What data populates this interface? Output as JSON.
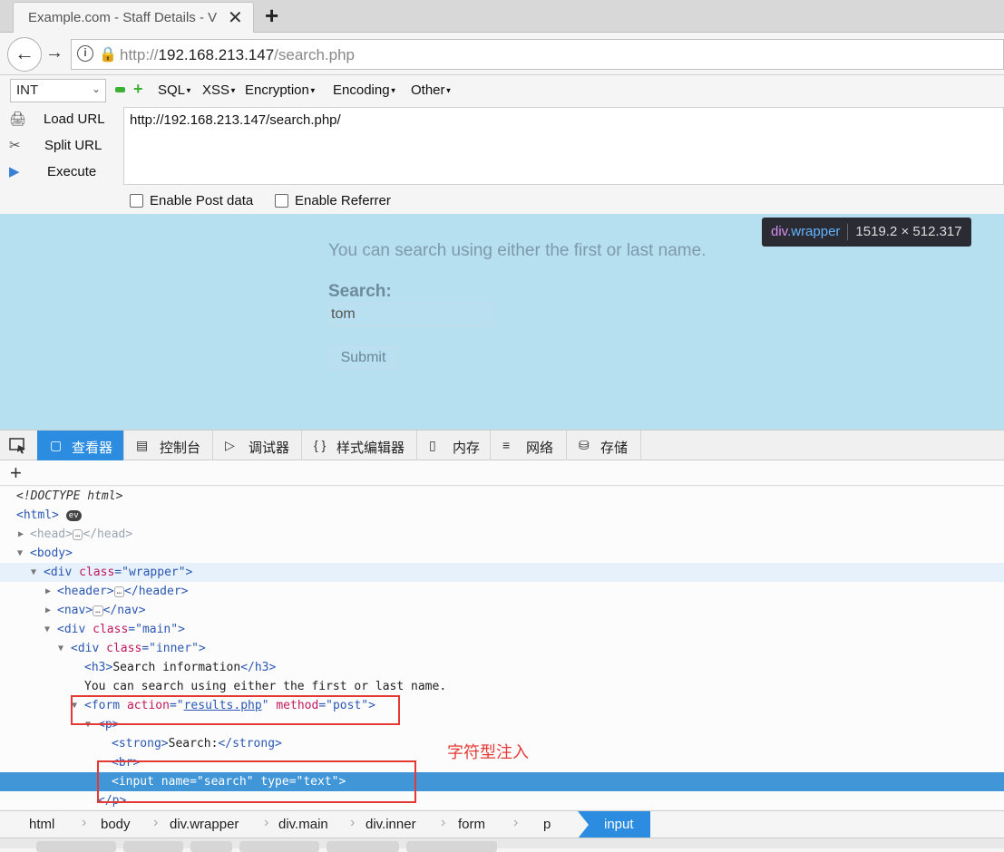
{
  "browser": {
    "tab_title": "Example.com - Staff Details - V",
    "tab_close": "✕",
    "new_tab": "+",
    "url_prefix": "http://",
    "url_host": "192.168.213.147",
    "url_path": "/search.php"
  },
  "hackbar": {
    "select_value": "INT",
    "menus": [
      "SQL",
      "XSS",
      "Encryption",
      "Encoding",
      "Other"
    ],
    "side_buttons": [
      {
        "label": "Load URL",
        "icon": "load-url-icon"
      },
      {
        "label": "Split URL",
        "icon": "split-url-icon"
      },
      {
        "label": "Execute",
        "icon": "execute-icon"
      }
    ],
    "url_value": "http://192.168.213.147/search.php/",
    "checkboxes": [
      "Enable Post data",
      "Enable Referrer"
    ]
  },
  "page": {
    "hint": "You can search using either the first or last name.",
    "search_label": "Search:",
    "search_value": "tom",
    "submit_label": "Submit",
    "tooltip_tag": "div",
    "tooltip_class": ".wrapper",
    "tooltip_dims": "1519.2 × 512.317"
  },
  "devtools": {
    "tabs": [
      {
        "label": "查看器",
        "icon": "inspector-icon"
      },
      {
        "label": "控制台",
        "icon": "console-icon"
      },
      {
        "label": "调试器",
        "icon": "debugger-icon"
      },
      {
        "label": "样式编辑器",
        "icon": "style-editor-icon"
      },
      {
        "label": "内存",
        "icon": "memory-icon"
      },
      {
        "label": "网络",
        "icon": "network-icon"
      },
      {
        "label": "存储",
        "icon": "storage-icon"
      }
    ],
    "markup": {
      "doctype": "<!DOCTYPE html>",
      "html_open": "<html>",
      "ev_badge": "ev",
      "head": "<head>",
      "head_close": "</head>",
      "body_open": "<body>",
      "div_wrapper": [
        "<div ",
        "class",
        "=\"",
        "wrapper",
        "\">"
      ],
      "header_open": "<header>",
      "header_close": "</header>",
      "nav_open": "<nav>",
      "nav_close": "</nav>",
      "div_main": [
        "<div ",
        "class",
        "=\"",
        "main",
        "\">"
      ],
      "div_inner": [
        "<div ",
        "class",
        "=\"",
        "inner",
        "\">"
      ],
      "h3_open": "<h3>",
      "h3_text": "Search information",
      "h3_close": "</h3>",
      "text_node": "You can search using either the first or last name.",
      "form": [
        "<form ",
        "action",
        "=\"",
        "results.php",
        "\" ",
        "method",
        "=\"",
        "post",
        "\">"
      ],
      "p_open": "<p>",
      "strong_open": "<strong>",
      "strong_text": "Search:",
      "strong_close": "</strong>",
      "br": "<br>",
      "input": [
        "<input ",
        "name",
        "=\"",
        "search",
        "\" ",
        "type",
        "=\"",
        "text",
        "\">"
      ],
      "p_close": "</p>",
      "ellipsis": "…"
    },
    "annotation": "字符型注入",
    "breadcrumbs": [
      "html",
      "body",
      "div.wrapper",
      "div.main",
      "div.inner",
      "form",
      "p"
    ],
    "breadcrumb_active": "input"
  }
}
